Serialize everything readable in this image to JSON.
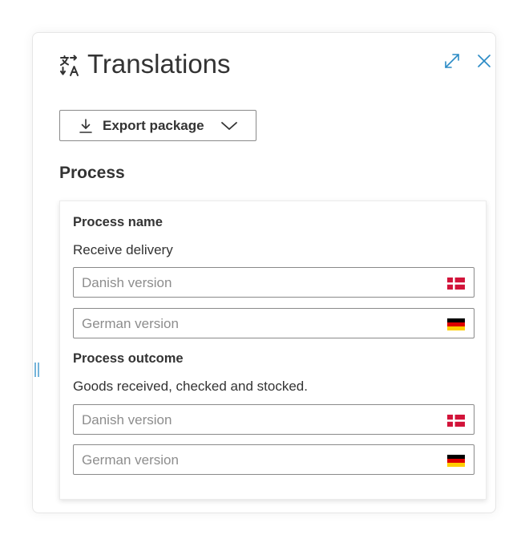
{
  "header": {
    "title": "Translations",
    "title_icon": "translate-icon",
    "expand_icon": "expand-icon",
    "close_icon": "close-icon"
  },
  "toolbar": {
    "export_label": "Export package",
    "export_icon": "download-icon",
    "dropdown_icon": "chevron-down-icon"
  },
  "section": {
    "title": "Process"
  },
  "fields": [
    {
      "label": "Process name",
      "value": "Receive delivery",
      "inputs": [
        {
          "placeholder": "Danish version",
          "flag": "danish-flag-icon"
        },
        {
          "placeholder": "German version",
          "flag": "german-flag-icon"
        }
      ]
    },
    {
      "label": "Process outcome",
      "value": "Goods received, checked and stocked.",
      "inputs": [
        {
          "placeholder": "Danish version",
          "flag": "danish-flag-icon"
        },
        {
          "placeholder": "German version",
          "flag": "german-flag-icon"
        }
      ]
    }
  ],
  "colors": {
    "accent": "#2b8bc6",
    "border": "#8a8a8a",
    "placeholder": "#8d8d8d",
    "text": "#333333",
    "denmark_red": "#d2143a",
    "germany_black": "#000000",
    "germany_red": "#dd0000",
    "germany_gold": "#ffce00"
  }
}
